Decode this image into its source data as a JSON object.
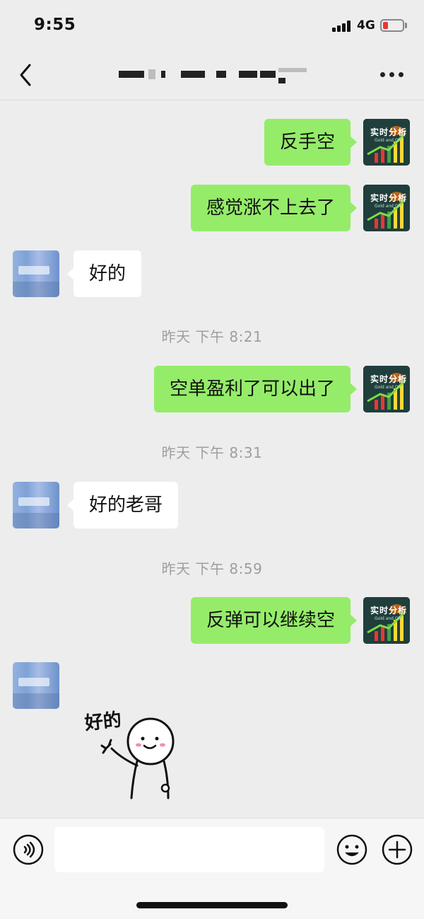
{
  "status_bar": {
    "time": "9:55",
    "network": "4G"
  },
  "header": {
    "title": ""
  },
  "messages": [
    {
      "side": "right",
      "text": "反手空"
    },
    {
      "side": "right",
      "text": "感觉涨不上去了"
    },
    {
      "side": "left",
      "text": "好的"
    },
    {
      "type": "time",
      "text": "昨天 下午 8:21"
    },
    {
      "side": "right",
      "text": "空单盈利了可以出了"
    },
    {
      "type": "time",
      "text": "昨天 下午 8:31"
    },
    {
      "side": "left",
      "text": "好的老哥"
    },
    {
      "type": "time",
      "text": "昨天 下午 8:59"
    },
    {
      "side": "right",
      "text": "反弹可以继续空"
    },
    {
      "side": "left",
      "type": "sticker",
      "text": "好的"
    }
  ],
  "self_avatar": {
    "brand": "实时分析",
    "sub": "Gold and Oil"
  },
  "input_bar": {
    "placeholder": ""
  },
  "colors": {
    "self_bubble": "#95ec69",
    "other_bubble": "#ffffff",
    "background": "#ededed"
  }
}
